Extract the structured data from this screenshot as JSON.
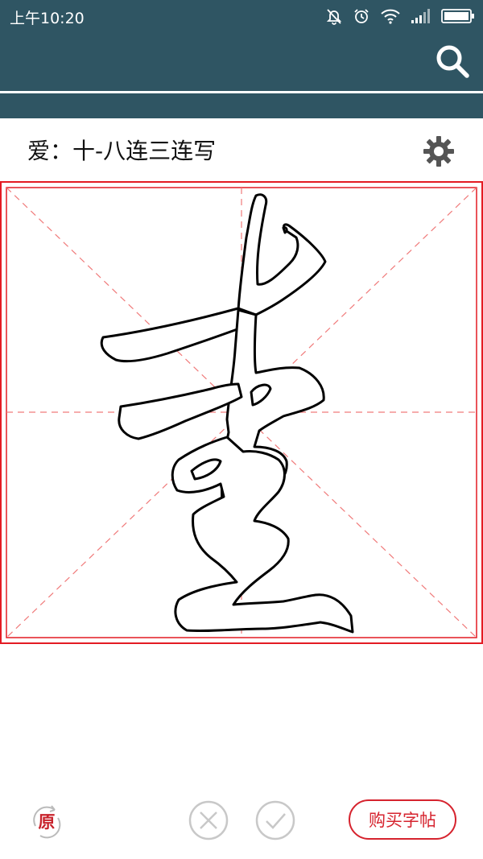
{
  "status_bar": {
    "time": "上午10:20"
  },
  "header": {
    "search_icon": "search-icon"
  },
  "title": {
    "text": "爱：十-八连三连写",
    "settings_icon": "gear-icon"
  },
  "grid": {
    "border_color": "#e31b23",
    "guide_color": "#f07a7a"
  },
  "toolbar": {
    "original_label": "原",
    "clear_icon": "close-circle-icon",
    "confirm_icon": "check-circle-icon",
    "buy_label": "购买字帖"
  },
  "colors": {
    "app_bar": "#2f5563",
    "accent": "#d6232e",
    "disabled_icon": "#c8c8c8"
  }
}
